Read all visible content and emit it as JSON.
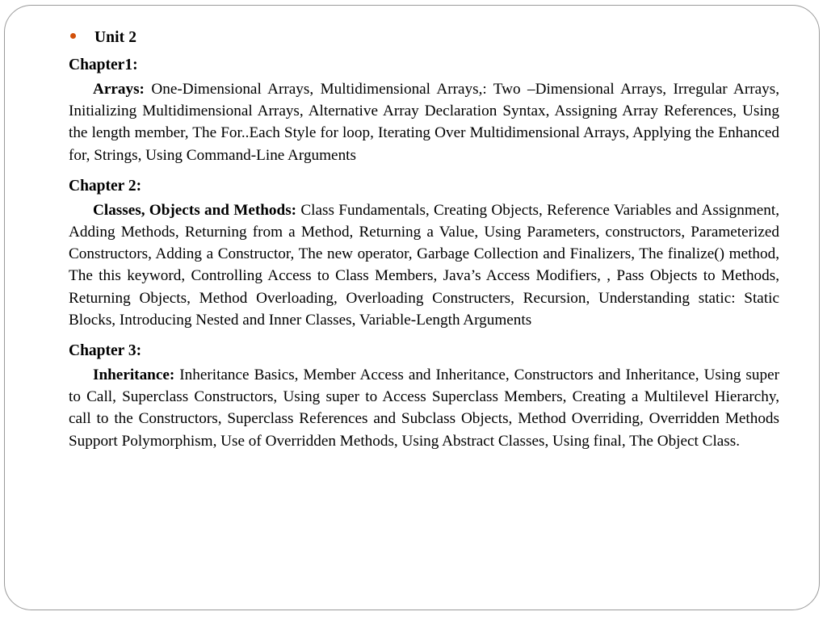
{
  "slide": {
    "frame_color": "#9a9a9a",
    "background_color": "#ffffff",
    "bullet_color": "#D2500A",
    "unit_title": "Unit 2",
    "sections": [
      {
        "heading": "Chapter1:",
        "lead": "Arrays:",
        "body": " One-Dimensional Arrays, Multidimensional Arrays,: Two –Dimensional Arrays, Irregular Arrays, Initializing Multidimensional Arrays, Alternative Array Declaration Syntax, Assigning Array References, Using the length member, The For..Each Style for loop, Iterating Over Multidimensional Arrays, Applying the Enhanced for, Strings, Using Command-Line Arguments"
      },
      {
        "heading": "Chapter 2:",
        "lead": "Classes, Objects and Methods:",
        "body": " Class Fundamentals, Creating Objects, Reference Variables and Assignment, Adding Methods, Returning from a Method, Returning a Value, Using Parameters, constructors, Parameterized Constructors, Adding a Constructor, The new operator, Garbage Collection and Finalizers, The finalize() method, The this keyword, Controlling Access to Class Members, Java’s Access Modifiers, , Pass Objects to Methods, Returning Objects, Method Overloading, Overloading Constructers, Recursion, Understanding static: Static Blocks, Introducing Nested and Inner Classes, Variable-Length Arguments"
      },
      {
        "heading": "Chapter 3:",
        "lead": "Inheritance:",
        "body": " Inheritance Basics, Member Access and Inheritance, Constructors and Inheritance, Using super to Call, Superclass Constructors, Using super to Access Superclass Members, Creating a Multilevel Hierarchy, call to the Constructors, Superclass References and Subclass Objects, Method Overriding, Overridden Methods Support Polymorphism, Use of Overridden Methods, Using Abstract Classes, Using final, The Object Class."
      }
    ]
  }
}
